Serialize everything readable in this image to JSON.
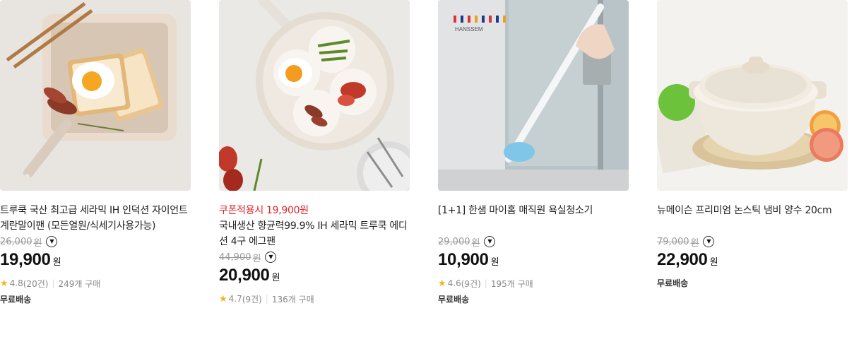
{
  "products": [
    {
      "title": "트루쿡 국산 최고급 세라믹 IH 인덕션 자이언트 계란말이팬 (모든열원/식세기사용가능)",
      "original_price": "26,000",
      "price": "19,900",
      "currency": "원",
      "rating": "4.8",
      "reviews": "(20건)",
      "purchases": "249개 구매",
      "shipping": "무료배송"
    },
    {
      "coupon": "쿠폰적용시 19,900원",
      "title": "국내생산 향균력99.9% IH 세라믹 트루쿡 에디션 4구 에그팬",
      "original_price": "44,900",
      "price": "20,900",
      "currency": "원",
      "rating": "4.7",
      "reviews": "(9건)",
      "purchases": "136개 구매"
    },
    {
      "title": "[1+1] 한샘 마이홈 매직원 욕실청소기",
      "brand_logo_text": "HANSSEM",
      "original_price": "29,000",
      "price": "10,900",
      "currency": "원",
      "rating": "4.6",
      "reviews": "(9건)",
      "purchases": "195개 구매",
      "shipping": "무료배송"
    },
    {
      "title": "뉴메이슨 프리미엄 논스틱 냄비 양수 20cm",
      "original_price": "79,000",
      "price": "22,900",
      "currency": "원",
      "shipping": "무료배송"
    }
  ],
  "icons": {
    "star": "star-icon",
    "info": "chevron-down-circle-icon"
  },
  "colors": {
    "coupon": "#e3242b",
    "star": "#f6b31b",
    "muted": "#999999"
  }
}
